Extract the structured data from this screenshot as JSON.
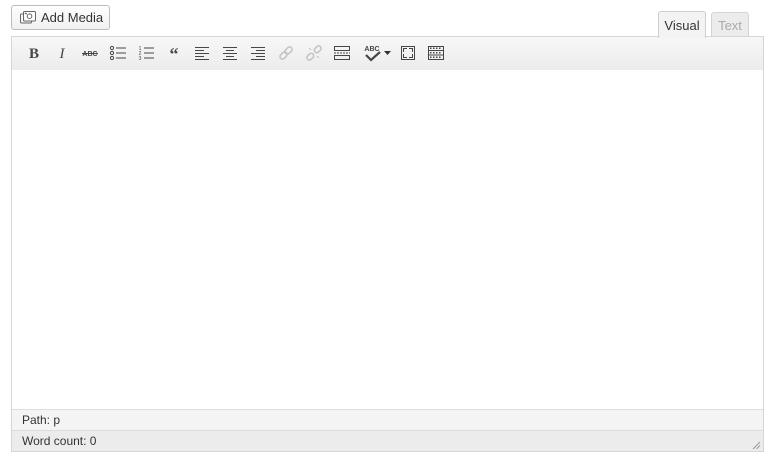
{
  "add_media": {
    "label": "Add Media",
    "icon": "media-camera-icon"
  },
  "tabs": [
    {
      "label": "Visual",
      "active": true
    },
    {
      "label": "Text",
      "active": false
    }
  ],
  "toolbar": {
    "buttons": [
      {
        "name": "bold",
        "icon": "bold-icon"
      },
      {
        "name": "italic",
        "icon": "italic-icon"
      },
      {
        "name": "strikethrough",
        "icon": "strikethrough-icon",
        "glyph": "ABC"
      },
      {
        "name": "bulleted-list",
        "icon": "bullet-list-icon"
      },
      {
        "name": "numbered-list",
        "icon": "numbered-list-icon"
      },
      {
        "name": "blockquote",
        "icon": "blockquote-icon"
      },
      {
        "name": "align-left",
        "icon": "align-left-icon"
      },
      {
        "name": "align-center",
        "icon": "align-center-icon"
      },
      {
        "name": "align-right",
        "icon": "align-right-icon"
      },
      {
        "name": "insert-link",
        "icon": "link-icon",
        "disabled": true
      },
      {
        "name": "remove-link",
        "icon": "unlink-icon",
        "disabled": true
      },
      {
        "name": "read-more",
        "icon": "read-more-icon"
      },
      {
        "name": "spellcheck",
        "icon": "spellcheck-icon",
        "glyph": "ABC"
      },
      {
        "name": "fullscreen",
        "icon": "fullscreen-icon"
      },
      {
        "name": "kitchen-sink",
        "icon": "kitchen-sink-icon"
      }
    ]
  },
  "status": {
    "path": "Path: p",
    "word_count": "Word count: 0"
  },
  "colors": {
    "toolbar_bg": "#ececec",
    "border": "#d6d6d6",
    "icon": "#464646",
    "icon_disabled": "#c4c4c4",
    "tab_inactive_text": "#aaaaaa"
  }
}
